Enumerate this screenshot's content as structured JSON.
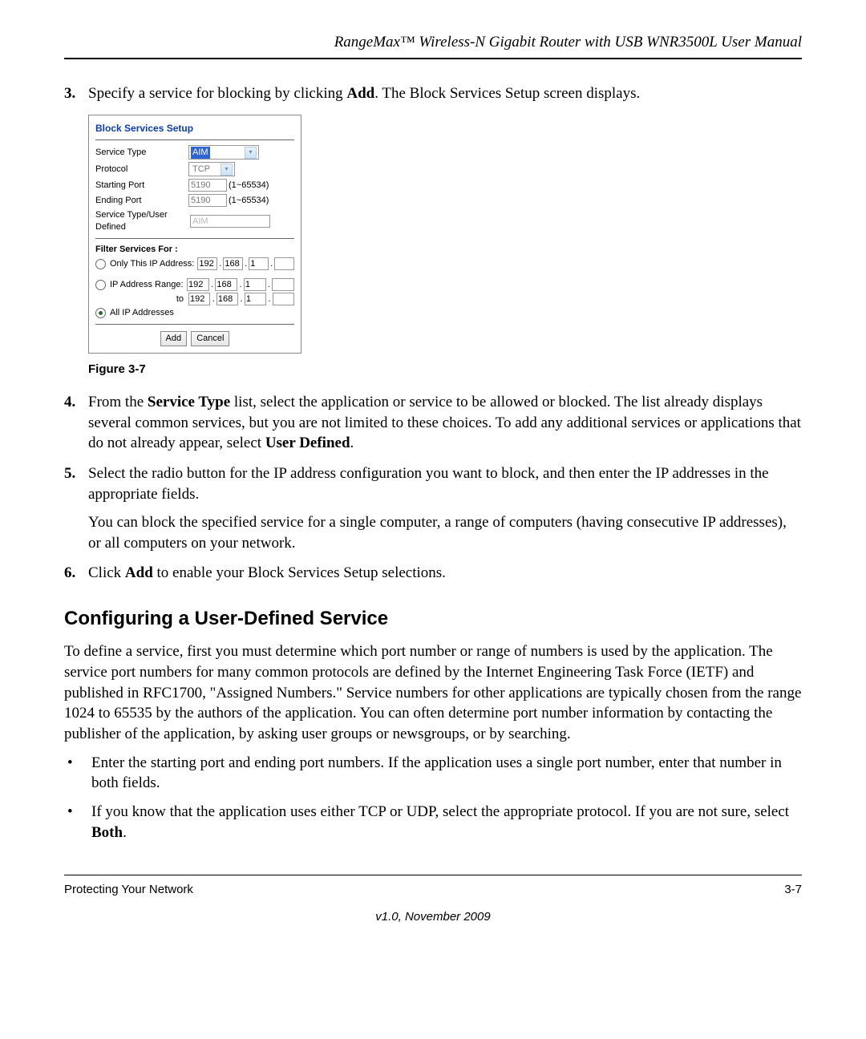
{
  "header": {
    "title": "RangeMax™ Wireless-N Gigabit Router with USB WNR3500L User Manual"
  },
  "step3": {
    "num": "3.",
    "pre": "Specify a service for blocking by clicking ",
    "bold": "Add",
    "post": ". The Block Services Setup screen displays."
  },
  "panel": {
    "title": "Block Services Setup",
    "rows": {
      "service_type_label": "Service Type",
      "service_type_value": "AIM",
      "protocol_label": "Protocol",
      "protocol_value": "TCP",
      "start_port_label": "Starting Port",
      "start_port_value": "5190",
      "start_port_range": "(1~65534)",
      "end_port_label": "Ending Port",
      "end_port_value": "5190",
      "end_port_range": "(1~65534)",
      "user_defined_label": "Service Type/User Defined",
      "user_defined_value": "AIM"
    },
    "filter": {
      "heading": "Filter Services For :",
      "only_label": "Only This IP Address:",
      "range_label": "IP Address Range:",
      "to_label": "to",
      "all_label": "All IP Addresses",
      "ip_only": [
        "192",
        "168",
        "1",
        ""
      ],
      "ip_range_from": [
        "192",
        "168",
        "1",
        ""
      ],
      "ip_range_to": [
        "192",
        "168",
        "1",
        ""
      ]
    },
    "buttons": {
      "add": "Add",
      "cancel": "Cancel"
    }
  },
  "figure_caption": "Figure 3-7",
  "step4": {
    "num": "4.",
    "t1": "From the ",
    "b1": "Service Type",
    "t2": " list, select the application or service to be allowed or blocked. The list already displays several common services, but you are not limited to these choices. To add any additional services or applications that do not already appear, select ",
    "b2": "User Defined",
    "t3": "."
  },
  "step5": {
    "num": "5.",
    "p1": "Select the radio button for the IP address configuration you want to block, and then enter the IP addresses in the appropriate fields.",
    "p2": "You can block the specified service for a single computer, a range of computers (having consecutive IP addresses), or all computers on your network."
  },
  "step6": {
    "num": "6.",
    "t1": "Click ",
    "b1": "Add",
    "t2": " to enable your Block Services Setup selections."
  },
  "section_heading": "Configuring a User-Defined Service",
  "section_para": "To define a service, first you must determine which port number or range of numbers is used by the application. The service port numbers for many common protocols are defined by the Internet Engineering Task Force (IETF) and published in RFC1700, \"Assigned Numbers.\" Service numbers for other applications are typically chosen from the range 1024 to 65535 by the authors of the application. You can often determine port number information by contacting the publisher of the application, by asking user groups or newsgroups, or by searching.",
  "bullet1": "Enter the starting port and ending port numbers. If the application uses a single port number, enter that number in both fields.",
  "bullet2": {
    "t1": "If you know that the application uses either TCP or UDP, select the appropriate protocol. If you are not sure, select ",
    "b1": "Both",
    "t2": "."
  },
  "footer": {
    "left": "Protecting Your Network",
    "right": "3-7",
    "version": "v1.0, November 2009"
  }
}
